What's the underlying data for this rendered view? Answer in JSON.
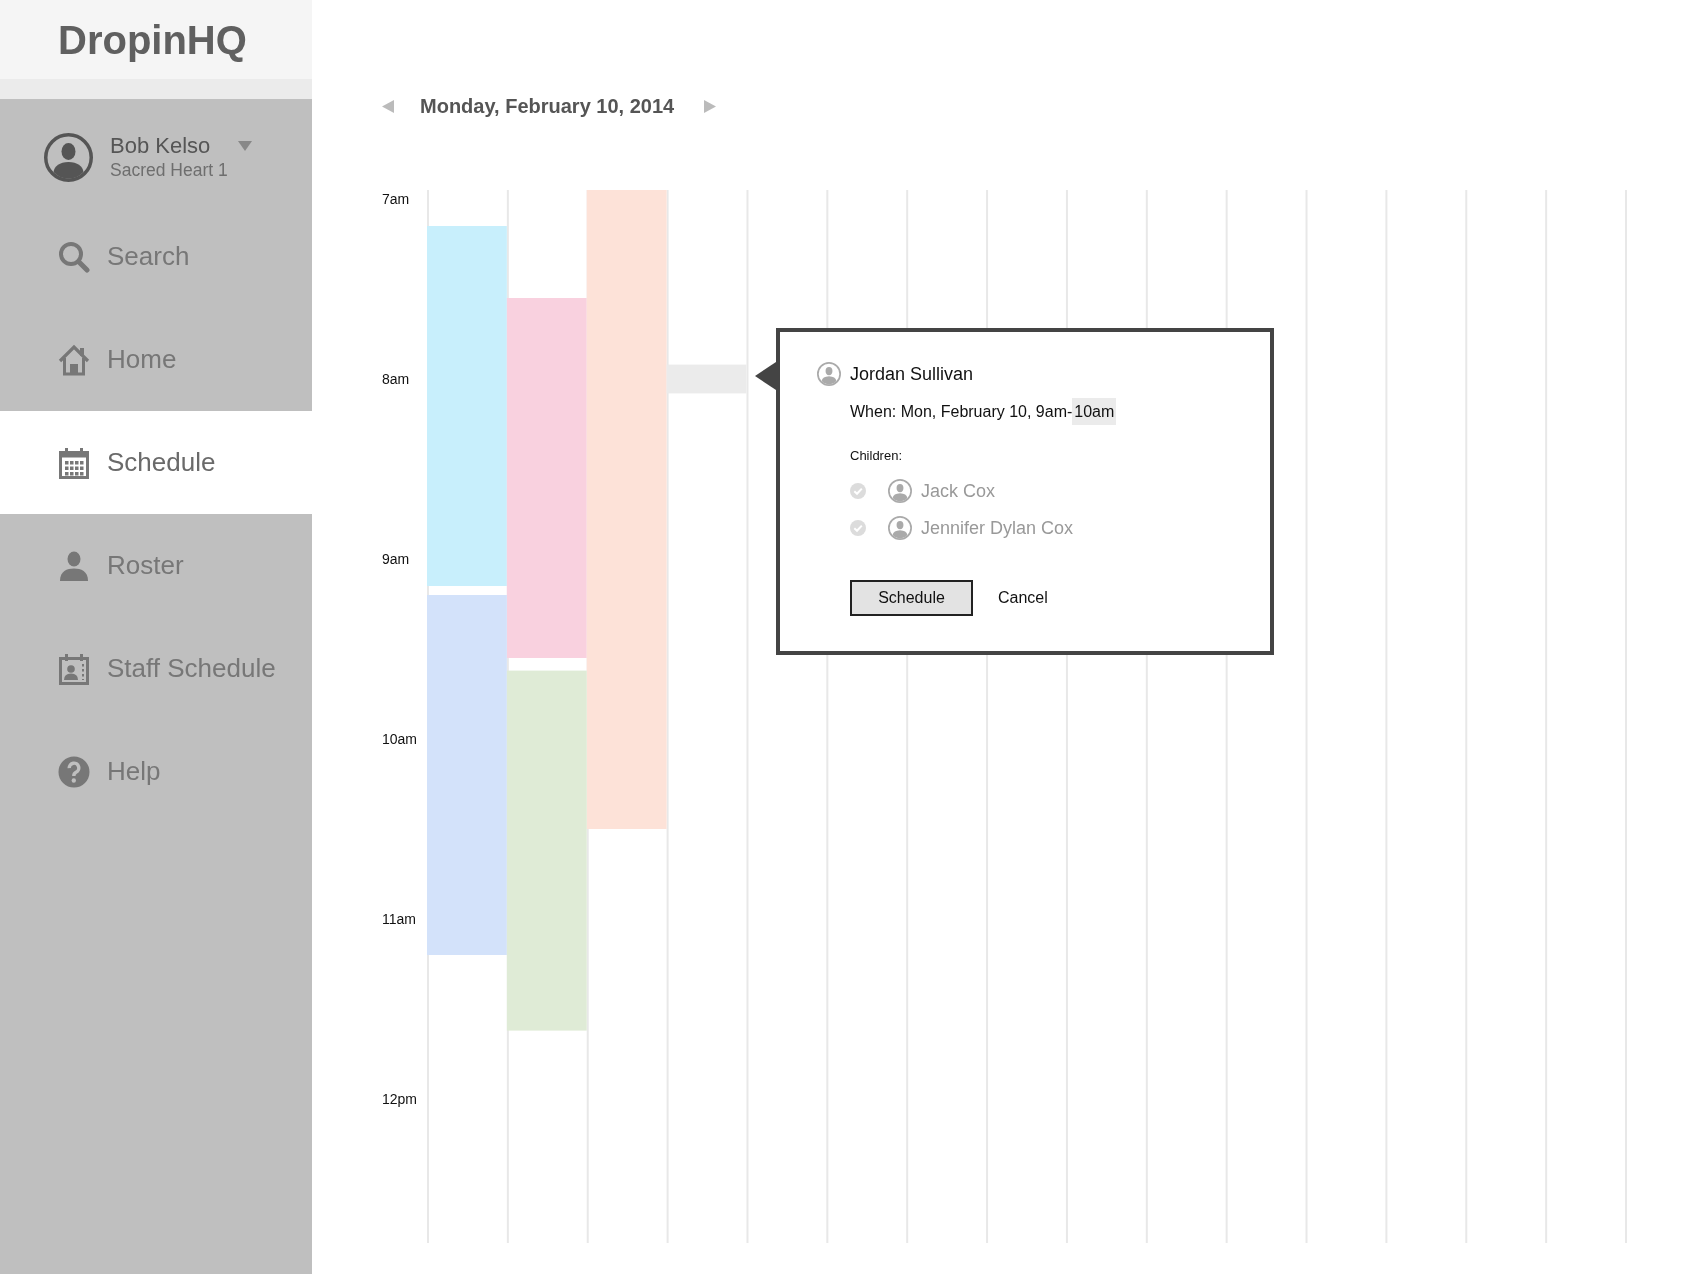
{
  "logo": "DropinHQ",
  "user": {
    "name": "Bob Kelso",
    "location": "Sacred Heart 1"
  },
  "nav": [
    {
      "label": "Search",
      "selected": false
    },
    {
      "label": "Home",
      "selected": false
    },
    {
      "label": "Schedule",
      "selected": true
    },
    {
      "label": "Roster",
      "selected": false
    },
    {
      "label": "Staff Schedule",
      "selected": false
    },
    {
      "label": "Help",
      "selected": false
    }
  ],
  "date_header": {
    "title": "Monday, February 10, 2014"
  },
  "schedule": {
    "time_labels": [
      "7am",
      "8am",
      "9am",
      "10am",
      "11am",
      "12pm"
    ],
    "events": [
      {
        "color": "#c8effc"
      },
      {
        "color": "#f9d1df"
      },
      {
        "color": "#fde2d8"
      },
      {
        "color": "#ebebeb"
      },
      {
        "color": "#d3e2fa"
      },
      {
        "color": "#dfebd6"
      }
    ]
  },
  "popup": {
    "name": "Jordan Sullivan",
    "when": [
      {
        "text": "When: Mon, February 10, 9am-",
        "highlighted": false
      },
      {
        "text": "10am",
        "highlighted": true
      }
    ],
    "children_label": "Children:",
    "children": [
      {
        "name": "Jack Cox",
        "checked": true
      },
      {
        "name": "Jennifer Dylan Cox",
        "checked": true
      }
    ],
    "buttons": [
      {
        "label": "Schedule",
        "kind": "primary"
      },
      {
        "label": "Cancel",
        "kind": "plain"
      }
    ]
  }
}
